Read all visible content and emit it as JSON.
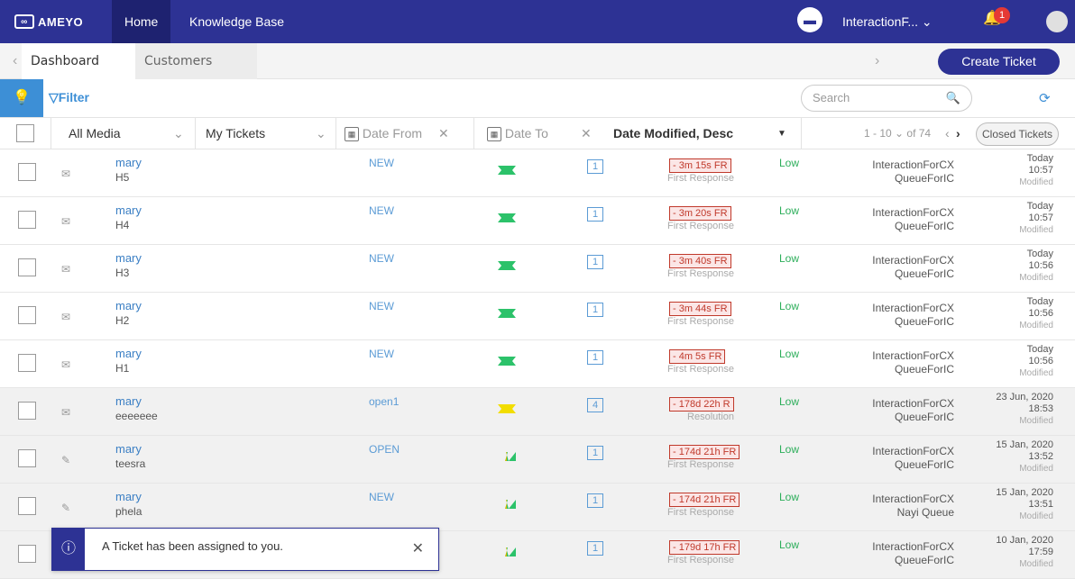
{
  "nav": {
    "logo": "AMEYO",
    "home": "Home",
    "kb": "Knowledge Base",
    "user": "InteractionF... ⌄",
    "notif": "1"
  },
  "tabs": {
    "dashboard": "Dashboard",
    "customers": "Customers",
    "create": "Create Ticket"
  },
  "toolbar": {
    "filter": "Filter",
    "search_placeholder": "Search"
  },
  "columns": {
    "media": "All Media",
    "tickets": "My Tickets",
    "date_from": "Date From",
    "date_to": "Date To",
    "sort": "Date Modified, Desc",
    "paging": "1 - 10 ⌄ of 74",
    "closed": "Closed Tickets"
  },
  "rows": [
    {
      "name": "mary",
      "subject": "H5",
      "status": "NEW",
      "priority_color": "green",
      "count": "1",
      "sla": "- 3m 15s FR",
      "sla_type": "First Response",
      "priority": "Low",
      "queue1": "InteractionForCX",
      "queue2": "QueueForIC",
      "d1": "Today",
      "d2": "10:57",
      "d3": "Modified"
    },
    {
      "name": "mary",
      "subject": "H4",
      "status": "NEW",
      "priority_color": "green",
      "count": "1",
      "sla": "- 3m 20s FR",
      "sla_type": "First Response",
      "priority": "Low",
      "queue1": "InteractionForCX",
      "queue2": "QueueForIC",
      "d1": "Today",
      "d2": "10:57",
      "d3": "Modified"
    },
    {
      "name": "mary",
      "subject": "H3",
      "status": "NEW",
      "priority_color": "green",
      "count": "1",
      "sla": "- 3m 40s FR",
      "sla_type": "First Response",
      "priority": "Low",
      "queue1": "InteractionForCX",
      "queue2": "QueueForIC",
      "d1": "Today",
      "d2": "10:56",
      "d3": "Modified"
    },
    {
      "name": "mary",
      "subject": "H2",
      "status": "NEW",
      "priority_color": "green",
      "count": "1",
      "sla": "- 3m 44s FR",
      "sla_type": "First Response",
      "priority": "Low",
      "queue1": "InteractionForCX",
      "queue2": "QueueForIC",
      "d1": "Today",
      "d2": "10:56",
      "d3": "Modified"
    },
    {
      "name": "mary",
      "subject": "H1",
      "status": "NEW",
      "priority_color": "green",
      "count": "1",
      "sla": "- 4m 5s FR",
      "sla_type": "First Response",
      "priority": "Low",
      "queue1": "InteractionForCX",
      "queue2": "QueueForIC",
      "d1": "Today",
      "d2": "10:56",
      "d3": "Modified"
    },
    {
      "name": "mary",
      "subject": "eeeeeee",
      "status": "open1",
      "priority_color": "yellow",
      "count": "4",
      "sla": "- 178d 22h R",
      "sla_type": "Resolution",
      "priority": "Low",
      "queue1": "InteractionForCX",
      "queue2": "QueueForIC",
      "d1": "23 Jun, 2020",
      "d2": "18:53",
      "d3": "Modified"
    },
    {
      "name": "mary",
      "subject": "teesra",
      "status": "OPEN",
      "priority_color": "mixed",
      "count": "1",
      "sla": "- 174d 21h FR",
      "sla_type": "First Response",
      "priority": "Low",
      "queue1": "InteractionForCX",
      "queue2": "QueueForIC",
      "d1": "15 Jan, 2020",
      "d2": "13:52",
      "d3": "Modified"
    },
    {
      "name": "mary",
      "subject": "phela",
      "status": "NEW",
      "priority_color": "mixed",
      "count": "1",
      "sla": "- 174d 21h FR",
      "sla_type": "First Response",
      "priority": "Low",
      "queue1": "InteractionForCX",
      "queue2": "Nayi Queue",
      "d1": "15 Jan, 2020",
      "d2": "13:51",
      "d3": "Modified"
    },
    {
      "name": "",
      "subject": "",
      "status": "",
      "priority_color": "mixed",
      "count": "1",
      "sla": "- 179d 17h FR",
      "sla_type": "First Response",
      "priority": "Low",
      "queue1": "InteractionForCX",
      "queue2": "QueueForIC",
      "d1": "10 Jan, 2020",
      "d2": "17:59",
      "d3": "Modified"
    }
  ],
  "toast": {
    "message": "A Ticket has been assigned to you."
  }
}
